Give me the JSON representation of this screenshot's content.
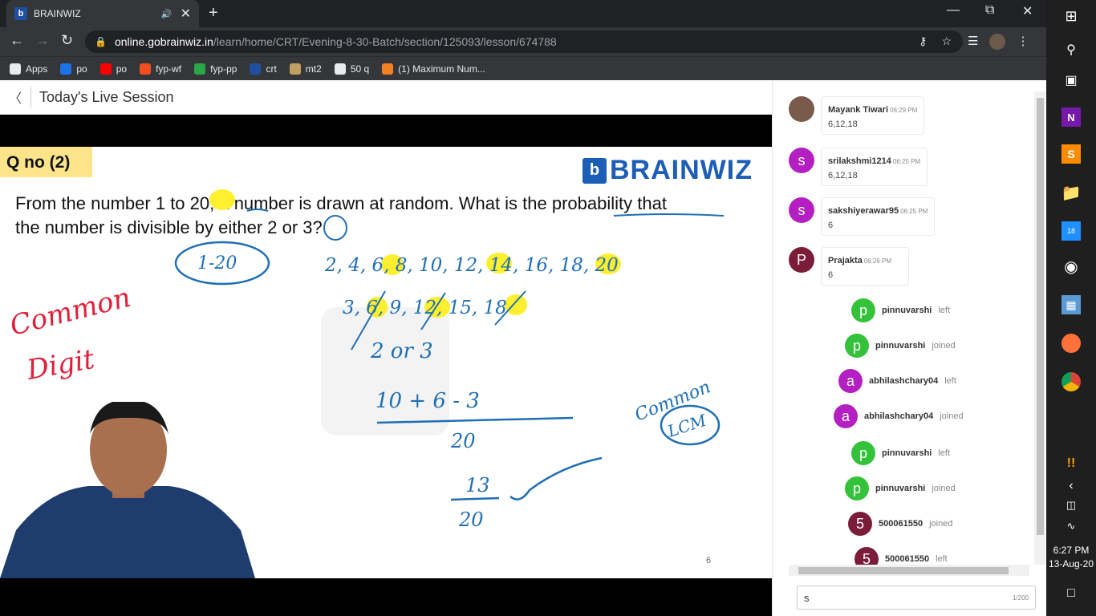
{
  "browser": {
    "tab_title": "BRAINWIZ",
    "tab_favicon": "b",
    "url_host": "online.gobrainwiz.in",
    "url_path": "/learn/home/CRT/Evening-8-30-Batch/section/125093/lesson/674788"
  },
  "bookmarks": [
    {
      "label": "Apps",
      "color": "#e8eaed"
    },
    {
      "label": "po",
      "color": "#1a73e8"
    },
    {
      "label": "po",
      "color": "#ff0000"
    },
    {
      "label": "fyp-wf",
      "color": "#f24e1e"
    },
    {
      "label": "fyp-pp",
      "color": "#27a845"
    },
    {
      "label": "crt",
      "color": "#1f4fa0"
    },
    {
      "label": "mt2",
      "color": "#c0a060"
    },
    {
      "label": "50 q",
      "color": "#e8eaed"
    },
    {
      "label": "(1) Maximum Num...",
      "color": "#f48024"
    }
  ],
  "page": {
    "title": "Today's Live Session"
  },
  "slide": {
    "qno": "Q no (2)",
    "brand": "BRAINWIZ",
    "brand_logo": "b",
    "question_l1": "From the number 1 to 20, a number is drawn at random. What is the probability that",
    "question_l2": "the number is divisible by either 2 or 3?",
    "slide_number": "6",
    "watermark": "BRAINWIZ"
  },
  "handwriting": {
    "range": "1-20",
    "multiples_2": "2, 4, 6, 8, 10, 12, 14, 16, 18, 20",
    "multiples_3": "3, 6, 9, 12, 15, 18",
    "or_line": "2   or   3",
    "sum": "10  +  6  - 3",
    "denom": "20",
    "result_num": "13",
    "result_den": "20",
    "common_lcm_1": "Common",
    "common_lcm_2": "LCM",
    "common_digit_1": "Common",
    "common_digit_2": "Digit"
  },
  "chat": {
    "messages": [
      {
        "initial": "",
        "name": "Mayank Tiwari",
        "time": "06:29 PM",
        "text": "6,12,18",
        "color": "#7a5a4a"
      },
      {
        "initial": "s",
        "name": "srilakshmi1214",
        "time": "06:25 PM",
        "text": "6,12,18",
        "color": "#b41fc1"
      },
      {
        "initial": "s",
        "name": "sakshiyerawar95",
        "time": "06:25 PM",
        "text": "6",
        "color": "#b41fc1"
      },
      {
        "initial": "P",
        "name": "Prajakta",
        "time": "06:26 PM",
        "text": "6",
        "color": "#7b1c3a"
      }
    ],
    "events": [
      {
        "initial": "p",
        "name": "pinnuvarshi",
        "status": "left",
        "color": "#34c23a"
      },
      {
        "initial": "p",
        "name": "pinnuvarshi",
        "status": "joined",
        "color": "#34c23a"
      },
      {
        "initial": "a",
        "name": "abhilashchary04",
        "status": "left",
        "color": "#b41fc1"
      },
      {
        "initial": "a",
        "name": "abhilashchary04",
        "status": "joined",
        "color": "#b41fc1"
      },
      {
        "initial": "p",
        "name": "pinnuvarshi",
        "status": "left",
        "color": "#34c23a"
      },
      {
        "initial": "p",
        "name": "pinnuvarshi",
        "status": "joined",
        "color": "#34c23a"
      },
      {
        "initial": "5",
        "name": "500061550",
        "status": "joined",
        "color": "#7b1c3a"
      },
      {
        "initial": "5",
        "name": "500061550",
        "status": "left",
        "color": "#7b1c3a"
      }
    ],
    "input_value": "s",
    "char_count": "1/200"
  },
  "taskbar": {
    "time": "6:27 PM",
    "date": "13-Aug-20",
    "badge_count": "18"
  }
}
